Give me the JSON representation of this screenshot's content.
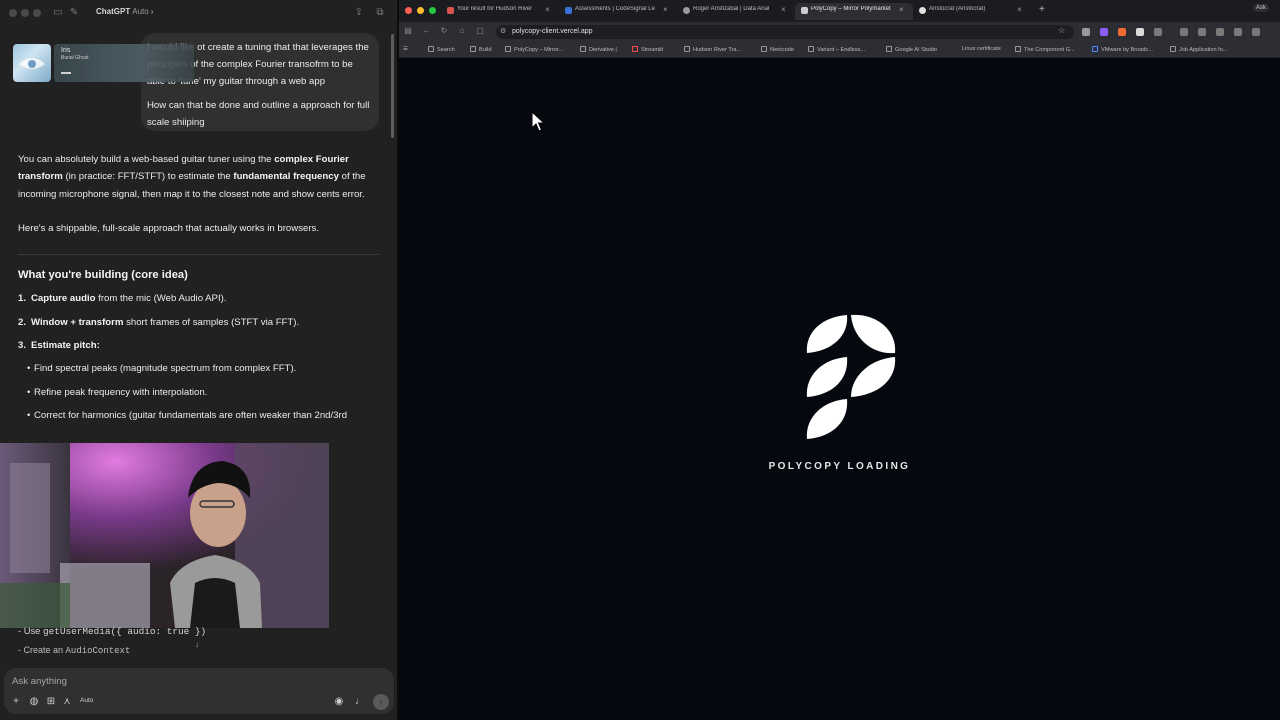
{
  "chat_app": {
    "window_title": "ChatGPT",
    "model_label": "Auto",
    "now_playing": {
      "title": "Iris",
      "artist": "Burial Ghost"
    },
    "user_message": {
      "line1": "I would like ot create a tuning that that leverages the principles of the complex Fourier transofrm to be able to 'tune' my guitar through a web app",
      "line2": "How can that be done and outline a approach for full scale shiiping"
    },
    "reply": {
      "intro_pre": "You can absolutely build a web-based guitar tuner using the ",
      "intro_b1": "complex Fourier transform",
      "intro_mid1": " (in practice: FFT/STFT) to estimate the ",
      "intro_b2": "fundamental frequency",
      "intro_post": " of the incoming microphone signal, then map it to the closest note and show cents error.",
      "para2": "Here's a shippable, full-scale approach that actually works in browsers.",
      "heading": "What you're building (core idea)",
      "steps": [
        {
          "num": "1.",
          "bold": "Capture audio",
          "rest": " from the mic (Web Audio API)."
        },
        {
          "num": "2.",
          "bold": "Window + transform",
          "rest": " short frames of samples (STFT via FFT)."
        },
        {
          "num": "3.",
          "bold": "Estimate pitch:",
          "rest": ""
        }
      ],
      "bullets": [
        "Find spectral peaks (magnitude spectrum from complex FFT).",
        "Refine peak frequency with interpolation.",
        "Correct for harmonics (guitar fundamentals are often weaker than 2nd/3rd"
      ],
      "code_line1_label": "- Use ",
      "code_line1_code": "getUserMedia({ audio: true })",
      "code_line2_label": "- Create an ",
      "code_line2_code": "AudioContext"
    },
    "composer": {
      "placeholder": "Ask anything",
      "mode": "Auto"
    }
  },
  "browser": {
    "tabs": [
      {
        "label": "Your result for Hudson River",
        "icon_color": "#d9534f",
        "active": false
      },
      {
        "label": "Assessments | CodeSignal Le",
        "icon_color": "#3b6fd8",
        "active": false
      },
      {
        "label": "Roger Aristizabal | Data Anal",
        "icon_color": "#9a9a9a",
        "active": false
      },
      {
        "label": "PolyCopy – Mirror Polymarket",
        "icon_color": "#cccccc",
        "active": true
      },
      {
        "label": "Aristocrat (Aristocrat)",
        "icon_color": "#e0e0e0",
        "active": false
      }
    ],
    "tab_extra": "Ask",
    "url": "polycopy-client.vercel.app",
    "bookmarks": [
      "Search",
      "Build",
      "PolyCopy – Mirror...",
      "Derivative |",
      "Streamlit",
      "Hudson River Tra...",
      "Neetcode",
      "Variant – Endless...",
      "Google AI Studio",
      "Linux certificate",
      "The Component G...",
      "VMware by Broadc...",
      "Job Application fo..."
    ],
    "page": {
      "loading_text": "POLYCOPY LOADING"
    }
  },
  "colors": {
    "chat_bg": "#212121",
    "bubble_bg": "#303030",
    "browser_page_bg": "#06080f",
    "close": "#ff5f57",
    "minimize": "#febc2e",
    "maximize": "#28c840"
  }
}
